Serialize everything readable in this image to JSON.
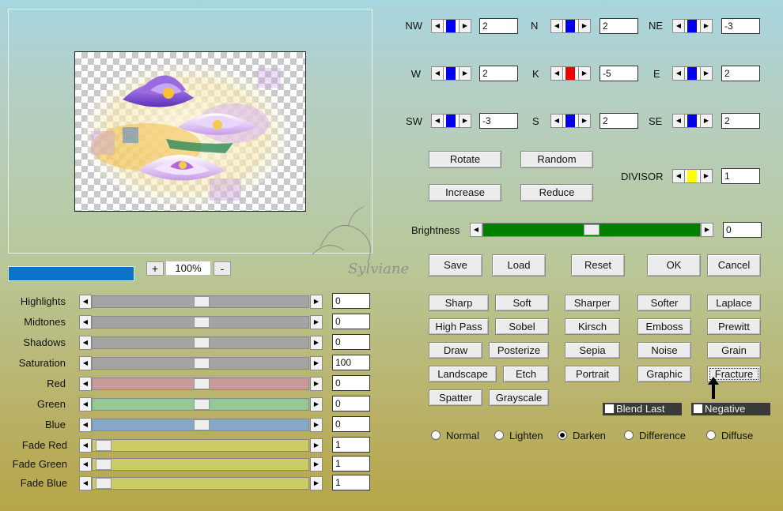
{
  "preview": {
    "zoom_value": "100%",
    "zoom_plus": "+",
    "zoom_minus": "-"
  },
  "watermark": "Sylviane",
  "arrows": {
    "left": "◀",
    "right": "▶"
  },
  "colors": {
    "blue_thumb": "#0000ee",
    "red_thumb": "#ee0000",
    "yellow_thumb": "#ffff00",
    "brightness_track": "#008000",
    "progress_bar": "#0a72c8"
  },
  "kernel": {
    "NW": {
      "label": "NW",
      "value": "2"
    },
    "N": {
      "label": "N",
      "value": "2"
    },
    "NE": {
      "label": "NE",
      "value": "-3"
    },
    "W": {
      "label": "W",
      "value": "2"
    },
    "K": {
      "label": "K",
      "value": "-5"
    },
    "E": {
      "label": "E",
      "value": "2"
    },
    "SW": {
      "label": "SW",
      "value": "-3"
    },
    "S": {
      "label": "S",
      "value": "2"
    },
    "SE": {
      "label": "SE",
      "value": "2"
    }
  },
  "divisor": {
    "label": "DIVISOR",
    "value": "1"
  },
  "brightness": {
    "label": "Brightness",
    "value": "0"
  },
  "buttons": {
    "rotate": "Rotate",
    "random": "Random",
    "increase": "Increase",
    "reduce": "Reduce",
    "save": "Save",
    "load": "Load",
    "reset": "Reset",
    "ok": "OK",
    "cancel": "Cancel"
  },
  "presets": [
    "Sharp",
    "Soft",
    "Sharper",
    "Softer",
    "Laplace",
    "High Pass",
    "Sobel",
    "Kirsch",
    "Emboss",
    "Prewitt",
    "Draw",
    "Posterize",
    "Sepia",
    "Noise",
    "Grain",
    "Landscape",
    "Etch",
    "Portrait",
    "Graphic",
    "Fracture",
    "Spatter",
    "Grayscale"
  ],
  "checkboxes": {
    "blend_last": "Blend Last",
    "negative": "Negative"
  },
  "modes": {
    "normal": "Normal",
    "lighten": "Lighten",
    "darken": "Darken",
    "difference": "Difference",
    "diffuse": "Diffuse",
    "selected": "Darken"
  },
  "adjustments": {
    "highlights": {
      "label": "Highlights",
      "value": "0"
    },
    "midtones": {
      "label": "Midtones",
      "value": "0"
    },
    "shadows": {
      "label": "Shadows",
      "value": "0"
    },
    "saturation": {
      "label": "Saturation",
      "value": "100"
    },
    "red": {
      "label": "Red",
      "value": "0"
    },
    "green": {
      "label": "Green",
      "value": "0"
    },
    "blue": {
      "label": "Blue",
      "value": "0"
    },
    "fade_red": {
      "label": "Fade Red",
      "value": "1"
    },
    "fade_green": {
      "label": "Fade Green",
      "value": "1"
    },
    "fade_blue": {
      "label": "Fade Blue",
      "value": "1"
    }
  }
}
